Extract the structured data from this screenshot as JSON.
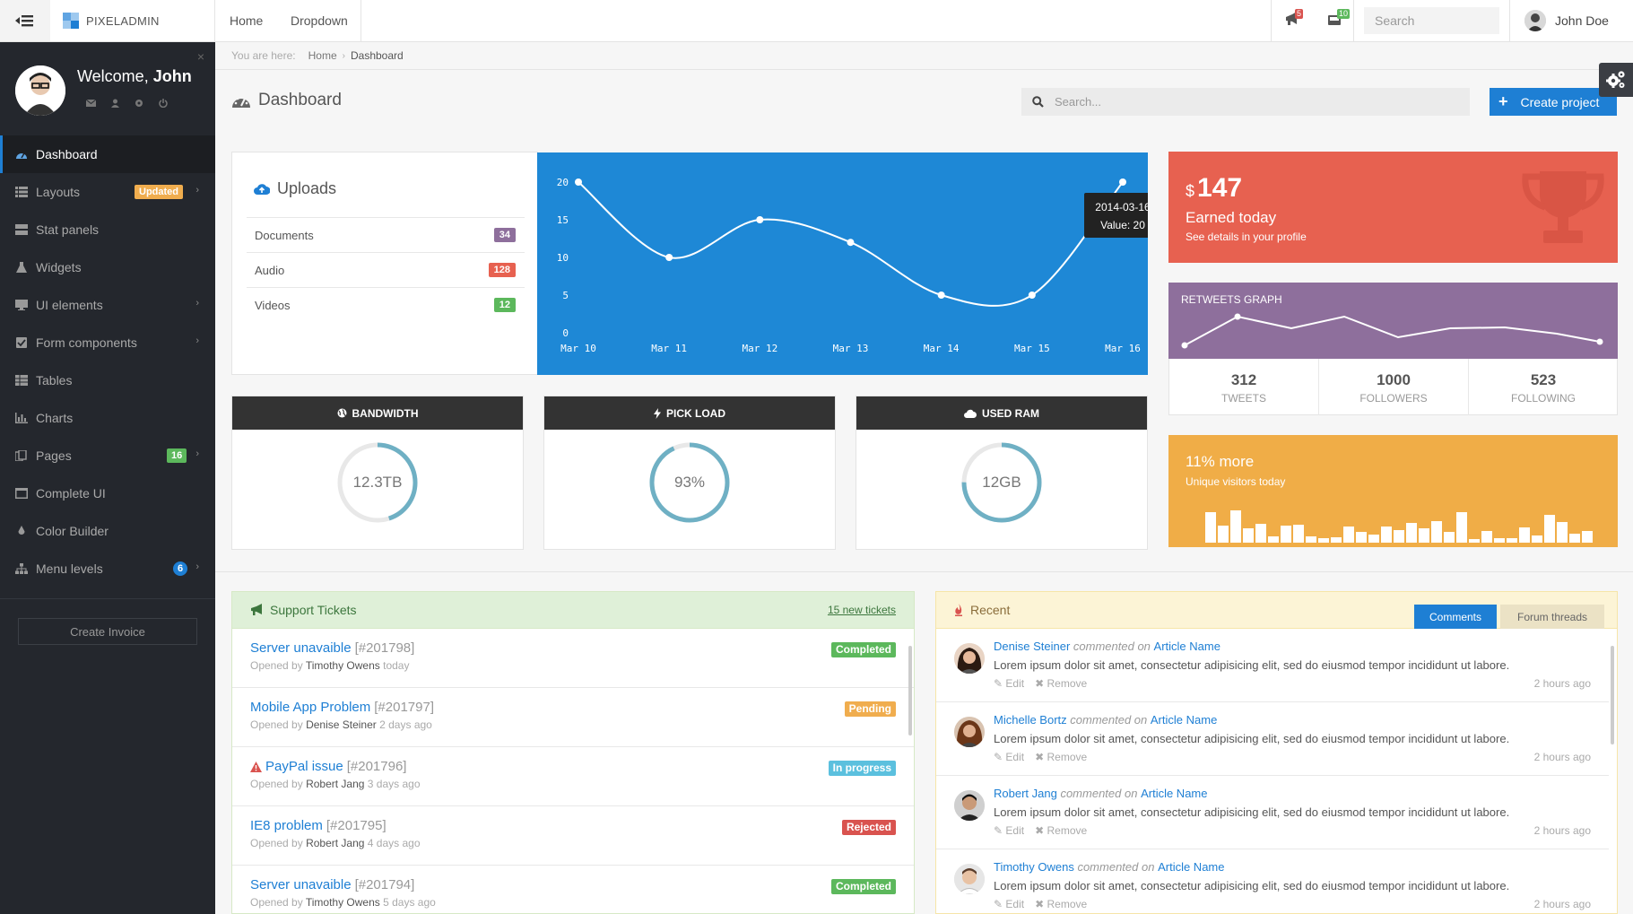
{
  "topbar": {
    "brand": "PIXELADMIN",
    "nav": [
      "Home",
      "Dropdown"
    ],
    "notifications": {
      "alerts": "5",
      "messages": "10"
    },
    "search_placeholder": "Search",
    "user_name": "John Doe"
  },
  "sidebar": {
    "welcome": "Welcome,",
    "welcome_name": "John",
    "items": [
      {
        "label": "Dashboard",
        "icon": "dashboard-icon"
      },
      {
        "label": "Layouts",
        "icon": "layouts-icon",
        "badge": "Updated"
      },
      {
        "label": "Stat panels",
        "icon": "stat-panels-icon"
      },
      {
        "label": "Widgets",
        "icon": "flask-icon"
      },
      {
        "label": "UI elements",
        "icon": "desktop-icon"
      },
      {
        "label": "Form components",
        "icon": "checkbox-icon"
      },
      {
        "label": "Tables",
        "icon": "table-icon"
      },
      {
        "label": "Charts",
        "icon": "bar-chart-icon"
      },
      {
        "label": "Pages",
        "icon": "files-icon",
        "badge": "16"
      },
      {
        "label": "Complete UI",
        "icon": "window-icon"
      },
      {
        "label": "Color Builder",
        "icon": "tint-icon"
      },
      {
        "label": "Menu levels",
        "icon": "sitemap-icon",
        "badge": "6"
      }
    ],
    "create_invoice": "Create Invoice"
  },
  "breadcrumb": {
    "prefix": "You are here:",
    "items": [
      "Home",
      "Dashboard"
    ]
  },
  "page": {
    "title": "Dashboard",
    "search_placeholder": "Search...",
    "create_project": "Create project"
  },
  "uploads": {
    "title": "Uploads",
    "rows": [
      {
        "label": "Documents",
        "count": "34"
      },
      {
        "label": "Audio",
        "count": "128"
      },
      {
        "label": "Videos",
        "count": "12"
      }
    ]
  },
  "chart_data": {
    "type": "line",
    "x": [
      "Mar 10",
      "Mar 11",
      "Mar 12",
      "Mar 13",
      "Mar 14",
      "Mar 15",
      "Mar 16"
    ],
    "values": [
      20,
      10,
      15,
      12,
      5,
      5,
      20
    ],
    "ylim": [
      0,
      20
    ],
    "yticks": [
      "0",
      "5",
      "10",
      "15",
      "20"
    ],
    "tooltip": {
      "date": "2014-03-16",
      "value": "Value: 20"
    },
    "color": "#1e88d6"
  },
  "stats": [
    {
      "title": "BANDWIDTH",
      "value": "12.3TB",
      "percent": 0.45,
      "icon": "globe-icon"
    },
    {
      "title": "PICK LOAD",
      "value": "93%",
      "percent": 0.93,
      "icon": "bolt-icon"
    },
    {
      "title": "USED RAM",
      "value": "12GB",
      "percent": 0.75,
      "icon": "cloud-icon"
    }
  ],
  "earned": {
    "currency": "$",
    "amount": "147",
    "label": "Earned today",
    "sub": "See details in your profile"
  },
  "retweets": {
    "title": "RETWEETS GRAPH",
    "cols": [
      {
        "n": "312",
        "l": "TWEETS"
      },
      {
        "n": "1000",
        "l": "FOLLOWERS"
      },
      {
        "n": "523",
        "l": "FOLLOWING"
      }
    ]
  },
  "visitors": {
    "big": "11% more",
    "sub": "Unique visitors today"
  },
  "tickets": {
    "title": "Support Tickets",
    "new_link": "15 new tickets",
    "opened_by": "Opened by",
    "items": [
      {
        "title": "Server unavaible",
        "num": "[#201798]",
        "by": "Timothy Owens",
        "when": "today",
        "status": "Completed",
        "color": "#5cb85c"
      },
      {
        "title": "Mobile App Problem",
        "num": "[#201797]",
        "by": "Denise Steiner",
        "when": "2 days ago",
        "status": "Pending",
        "color": "#f0ad4e"
      },
      {
        "title": "PayPal issue",
        "num": "[#201796]",
        "by": "Robert Jang",
        "when": "3 days ago",
        "status": "In progress",
        "color": "#5bc0de",
        "warning": true
      },
      {
        "title": "IE8 problem",
        "num": "[#201795]",
        "by": "Robert Jang",
        "when": "4 days ago",
        "status": "Rejected",
        "color": "#d9534f"
      },
      {
        "title": "Server unavaible",
        "num": "[#201794]",
        "by": "Timothy Owens",
        "when": "5 days ago",
        "status": "Completed",
        "color": "#5cb85c"
      }
    ]
  },
  "recent": {
    "title": "Recent",
    "tabs": [
      "Comments",
      "Forum threads"
    ],
    "commented_on": "commented on",
    "edit": "Edit",
    "remove": "Remove",
    "items": [
      {
        "name": "Denise Steiner",
        "article": "Article Name",
        "body": "Lorem ipsum dolor sit amet, consectetur adipisicing elit, sed do eiusmod tempor incididunt ut labore.",
        "time": "2 hours ago"
      },
      {
        "name": "Michelle Bortz",
        "article": "Article Name",
        "body": "Lorem ipsum dolor sit amet, consectetur adipisicing elit, sed do eiusmod tempor incididunt ut labore.",
        "time": "2 hours ago"
      },
      {
        "name": "Robert Jang",
        "article": "Article Name",
        "body": "Lorem ipsum dolor sit amet, consectetur adipisicing elit, sed do eiusmod tempor incididunt ut labore.",
        "time": "2 hours ago"
      },
      {
        "name": "Timothy Owens",
        "article": "Article Name",
        "body": "Lorem ipsum dolor sit amet, consectetur adipisicing elit, sed do eiusmod tempor incididunt ut labore.",
        "time": "2 hours ago"
      }
    ]
  }
}
